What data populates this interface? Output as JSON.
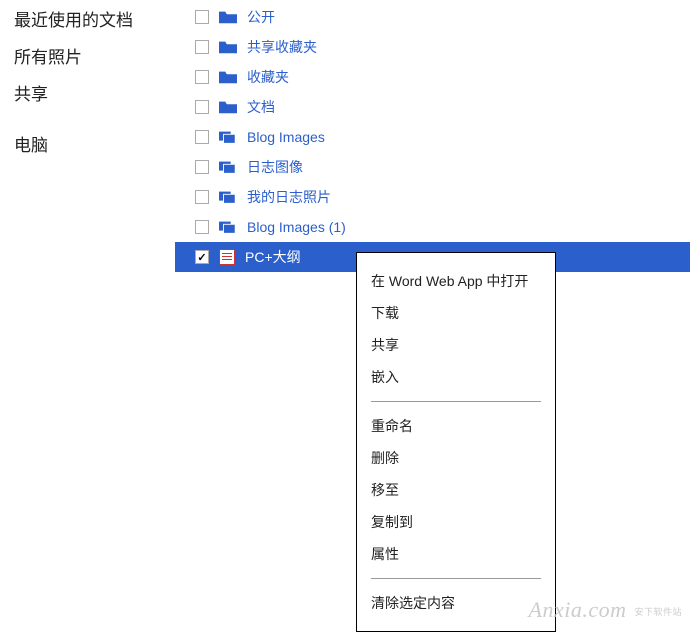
{
  "sidebar": {
    "items": [
      {
        "label": "最近使用的文档"
      },
      {
        "label": "所有照片"
      },
      {
        "label": "共享"
      }
    ],
    "computer": "电脑"
  },
  "files": [
    {
      "label": "公开",
      "icon": "folder",
      "checked": false
    },
    {
      "label": "共享收藏夹",
      "icon": "folder",
      "checked": false
    },
    {
      "label": "收藏夹",
      "icon": "folder",
      "checked": false
    },
    {
      "label": "文档",
      "icon": "folder",
      "checked": false
    },
    {
      "label": "Blog Images",
      "icon": "gallery",
      "checked": false
    },
    {
      "label": "日志图像",
      "icon": "gallery",
      "checked": false
    },
    {
      "label": "我的日志照片",
      "icon": "gallery",
      "checked": false
    },
    {
      "label": "Blog Images (1)",
      "icon": "gallery",
      "checked": false
    },
    {
      "label": "PC+大纲",
      "icon": "doc",
      "checked": true,
      "selected": true
    }
  ],
  "menu": {
    "group1": [
      "在 Word Web App 中打开",
      "下载",
      "共享",
      "嵌入"
    ],
    "group2": [
      "重命名",
      "删除",
      "移至",
      "复制到",
      "属性"
    ],
    "group3": [
      "清除选定内容"
    ]
  },
  "watermark": {
    "main": "Anxia",
    "ext": ".com",
    "sub": "安下软件站"
  }
}
